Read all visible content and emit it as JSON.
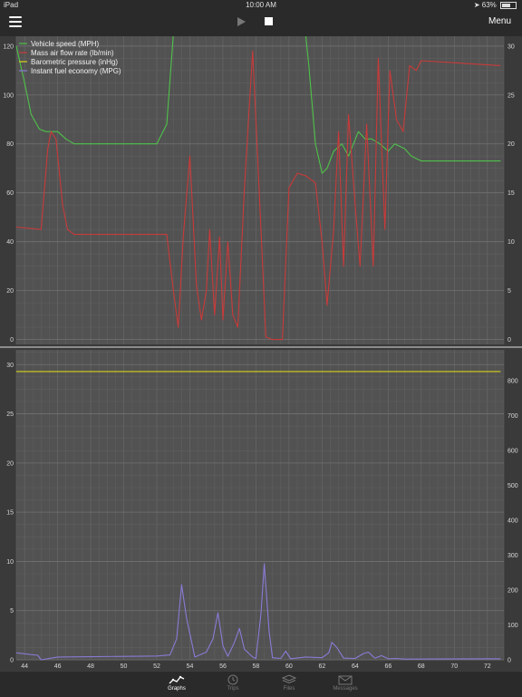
{
  "status_bar": {
    "device": "iPad",
    "time": "10:00 AM",
    "battery": "63%"
  },
  "toolbar": {
    "menu_label": "Menu"
  },
  "icons": {
    "menu": "hamburger-icon",
    "play": "play-icon",
    "stop": "stop-icon",
    "location": "location-arrow-icon",
    "battery": "battery-icon"
  },
  "tabs": [
    {
      "label": "Graphs",
      "icon": "graph-icon",
      "active": true
    },
    {
      "label": "Trips",
      "icon": "clock-icon",
      "active": false
    },
    {
      "label": "Files",
      "icon": "stack-icon",
      "active": false
    },
    {
      "label": "Messages",
      "icon": "mail-icon",
      "active": false
    }
  ],
  "chart_data": [
    {
      "type": "line",
      "legend_position": "top-left",
      "grid": true,
      "xlim": [
        43.5,
        73
      ],
      "x_ticks": [
        44,
        46,
        48,
        50,
        52,
        54,
        56,
        58,
        60,
        62,
        64,
        66,
        68,
        70,
        72
      ],
      "left_axis": {
        "ylim": [
          -2,
          124
        ],
        "ticks": [
          0,
          20,
          40,
          60,
          80,
          100,
          120
        ]
      },
      "right_axis": {
        "ylim": [
          -0.5,
          31
        ],
        "ticks": [
          0,
          5,
          10,
          15,
          20,
          25,
          30
        ]
      },
      "series": [
        {
          "name": "Vehicle speed (MPH)",
          "color": "#4fc24a",
          "axis": "left",
          "x": [
            43.5,
            44,
            44.4,
            44.9,
            45.3,
            46,
            46.5,
            47,
            49,
            52,
            52.6,
            53,
            53.3,
            58,
            61,
            61.2,
            61.6,
            62,
            62.3,
            62.7,
            63.2,
            63.6,
            64.2,
            64.6,
            65,
            65.5,
            66,
            66.4,
            67,
            67.4,
            68,
            72.8
          ],
          "y": [
            120,
            105,
            92,
            86,
            85,
            85,
            82,
            80,
            80,
            80,
            88,
            125,
            125,
            125,
            125,
            112,
            80,
            68,
            70,
            77,
            80,
            75,
            85,
            82,
            82,
            80,
            77,
            80,
            78,
            75,
            73,
            73
          ]
        },
        {
          "name": "Mass air flow rate (lb/min)",
          "color": "#c93a3a",
          "axis": "left",
          "x": [
            43.5,
            45,
            45.4,
            45.6,
            45.9,
            46.3,
            46.6,
            47,
            48,
            51,
            52.6,
            53,
            53.3,
            53.6,
            54,
            54.4,
            54.7,
            55,
            55.2,
            55.5,
            55.8,
            56,
            56.3,
            56.6,
            56.9,
            57.3,
            57.8,
            58.2,
            58.6,
            59,
            59.3,
            59.6,
            60,
            60.5,
            61,
            61.6,
            62,
            62.3,
            62.7,
            63,
            63.3,
            63.6,
            64,
            64.3,
            64.7,
            65.1,
            65.4,
            65.8,
            66.1,
            66.5,
            66.9,
            67.3,
            67.7,
            68,
            72.8
          ],
          "y": [
            46,
            45,
            78,
            85,
            82,
            55,
            45,
            43,
            43,
            43,
            43,
            20,
            5,
            42,
            75,
            22,
            8,
            20,
            45,
            10,
            42,
            8,
            40,
            10,
            5,
            62,
            118,
            60,
            1,
            0,
            0,
            0,
            62,
            68,
            67,
            64,
            40,
            14,
            45,
            85,
            30,
            92,
            55,
            30,
            88,
            30,
            115,
            45,
            110,
            90,
            85,
            112,
            110,
            114,
            112
          ]
        },
        {
          "name": "Barometric pressure (inHg)",
          "color": "#d7d31c",
          "axis": "right",
          "hidden_axis": true,
          "x": [
            43.5,
            72.8
          ],
          "y": [
            29.3,
            29.3
          ]
        },
        {
          "name": "Instant fuel economy (MPG)",
          "color": "#8a7bd6",
          "axis": "right",
          "hidden_axis": true,
          "x": [
            43.5,
            44.8,
            45,
            46,
            52,
            52.8,
            53.2,
            53.5,
            53.8,
            54.3,
            55,
            55.4,
            55.7,
            56,
            56.3,
            56.7,
            57,
            57.3,
            57.8,
            58,
            58.3,
            58.5,
            58.8,
            59,
            59.5,
            59.8,
            60.1,
            61,
            62,
            62.4,
            62.6,
            62.9,
            63.3,
            64,
            64.5,
            64.8,
            65.2,
            65.6,
            66,
            66.5,
            67,
            72.8
          ],
          "y": [
            20,
            13,
            0,
            8,
            11,
            14,
            60,
            215,
            120,
            8,
            22,
            60,
            135,
            40,
            10,
            50,
            90,
            30,
            8,
            4,
            130,
            275,
            80,
            6,
            4,
            25,
            3,
            8,
            6,
            20,
            50,
            35,
            5,
            4,
            18,
            22,
            5,
            12,
            3,
            4,
            2,
            3
          ]
        }
      ]
    },
    {
      "type": "line",
      "grid": true,
      "xlim": [
        43.5,
        73
      ],
      "x_ticks": [
        44,
        46,
        48,
        50,
        52,
        54,
        56,
        58,
        60,
        62,
        64,
        66,
        68,
        70,
        72
      ],
      "x_tick_labels": [
        "44",
        "46",
        "48",
        "50",
        "52",
        "54",
        "56",
        "58",
        "60",
        "62",
        "64",
        "66",
        "68",
        "70",
        "72"
      ],
      "left_axis": {
        "ylim": [
          0,
          31.5
        ],
        "ticks": [
          0,
          5,
          10,
          15,
          20,
          25,
          30
        ]
      },
      "right_axis": {
        "ylim": [
          0,
          888
        ],
        "ticks": [
          0,
          100,
          200,
          300,
          400,
          500,
          600,
          700,
          800
        ]
      },
      "series_refs": [
        "Barometric pressure (inHg)",
        "Instant fuel economy (MPG)"
      ]
    }
  ]
}
